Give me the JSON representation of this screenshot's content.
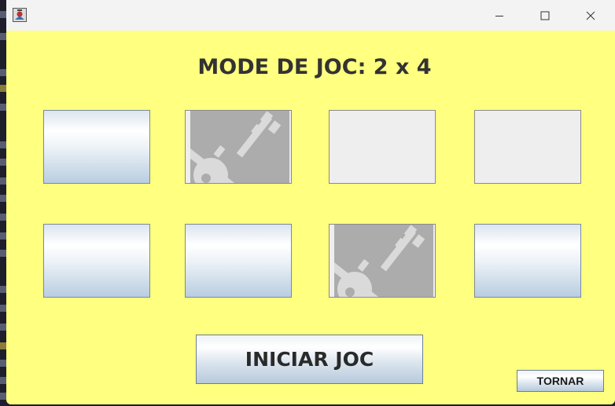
{
  "window": {
    "title": "",
    "controls": {
      "minimize_icon": "minimize-icon",
      "maximize_icon": "maximize-icon",
      "close_icon": "close-icon"
    }
  },
  "game": {
    "heading": "MODE DE JOC: 2 x 4",
    "rows": 2,
    "cols": 4,
    "cards": [
      {
        "state": "back"
      },
      {
        "state": "face",
        "image": "key-icon"
      },
      {
        "state": "empty"
      },
      {
        "state": "empty"
      },
      {
        "state": "back"
      },
      {
        "state": "back"
      },
      {
        "state": "face",
        "image": "key-icon"
      },
      {
        "state": "back"
      }
    ]
  },
  "buttons": {
    "start": "INICIAR JOC",
    "back": "TORNAR"
  },
  "colors": {
    "background": "#ffff80",
    "titlebar": "#f3f3f3",
    "heading_text": "#333333",
    "card_face": "#acacac"
  }
}
